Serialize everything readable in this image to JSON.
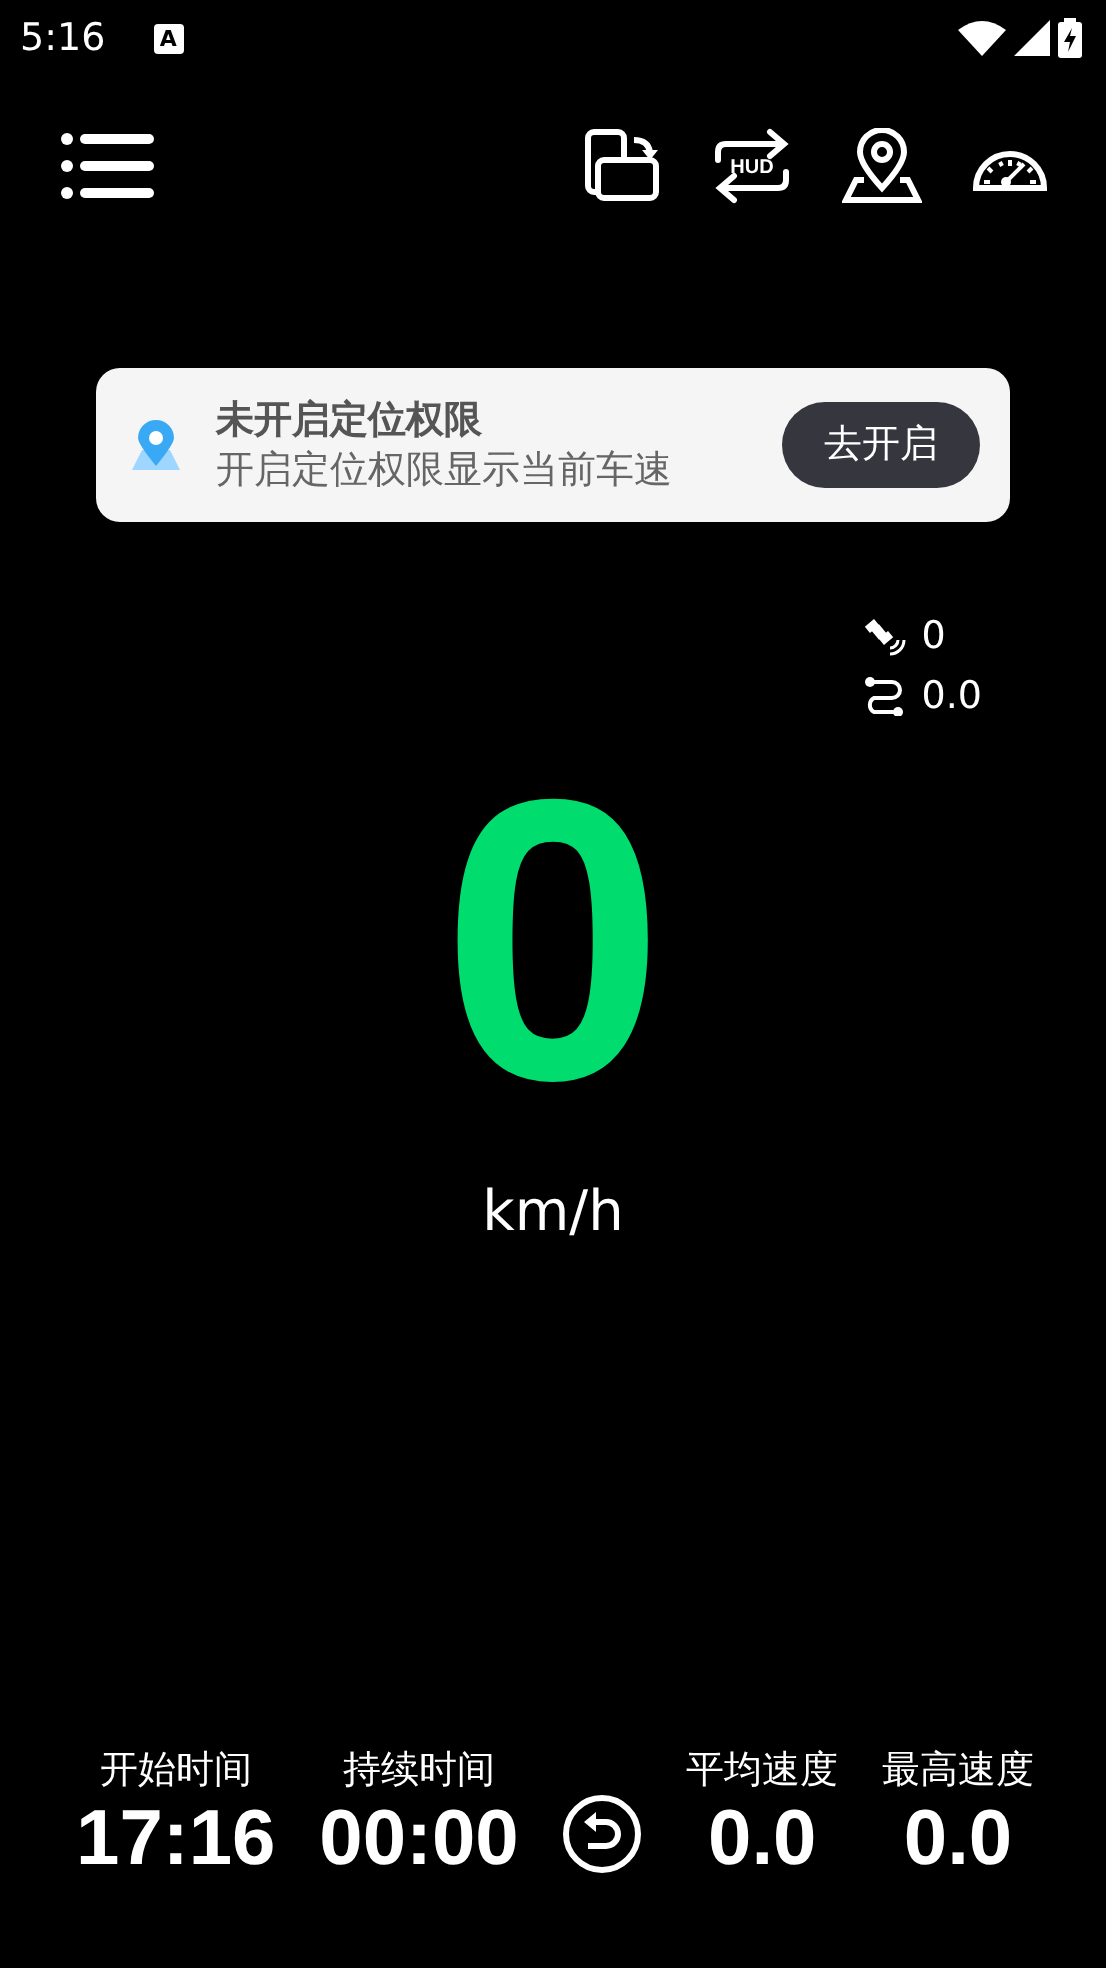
{
  "status_bar": {
    "time": "5:16",
    "notification_icon_label": "A"
  },
  "toolbar": {
    "hud_label": "HUD"
  },
  "permission_banner": {
    "title": "未开启定位权限",
    "subtitle": "开启定位权限显示当前车速",
    "button": "去开启"
  },
  "gps": {
    "satellites": "0",
    "distance": "0.0"
  },
  "speed": {
    "value": "0",
    "unit": "km/h"
  },
  "stats": [
    {
      "label": "开始时间",
      "value": "17:16"
    },
    {
      "label": "持续时间",
      "value": "00:00"
    },
    {
      "label": "平均速度",
      "value": "0.0"
    },
    {
      "label": "最高速度",
      "value": "0.0"
    }
  ]
}
